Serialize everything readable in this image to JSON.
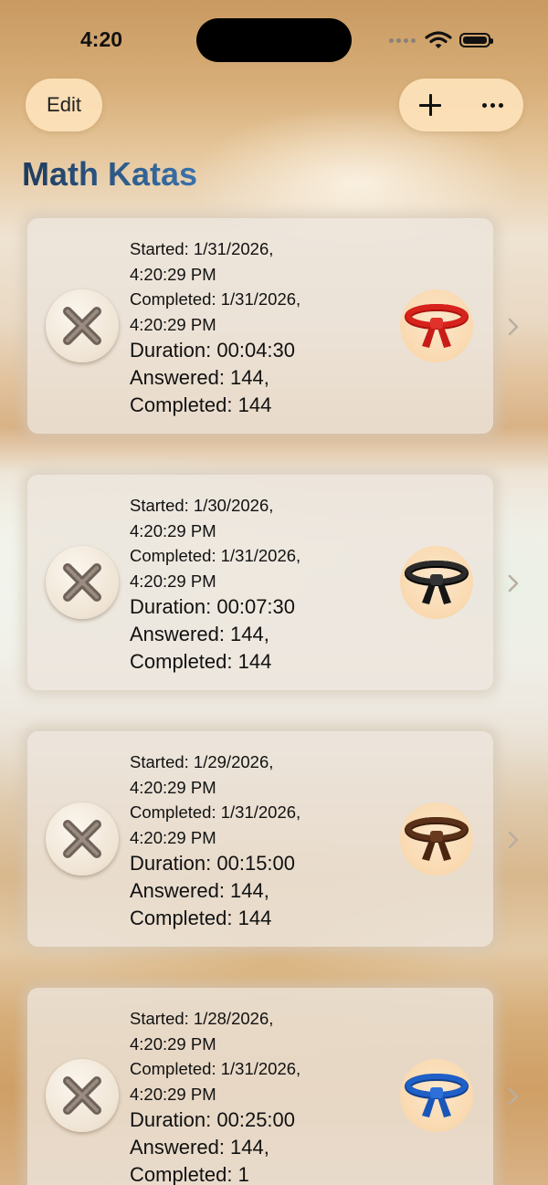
{
  "status_bar": {
    "time": "4:20"
  },
  "nav": {
    "edit_label": "Edit",
    "add_icon": "plus-icon",
    "more_icon": "ellipsis-icon"
  },
  "title": "Math Katas",
  "katas": [
    {
      "started": "Started: 1/31/2026,",
      "started_time": "4:20:29 PM",
      "completed": "Completed: 1/31/2026,",
      "completed_time": "4:20:29 PM",
      "duration": "Duration: 00:04:30",
      "answered": "Answered: 144,",
      "completed_count": "Completed: 144",
      "belt": "red-belt-icon",
      "belt_color": "#d8221c"
    },
    {
      "started": "Started: 1/30/2026,",
      "started_time": "4:20:29 PM",
      "completed": "Completed: 1/31/2026,",
      "completed_time": "4:20:29 PM",
      "duration": "Duration: 00:07:30",
      "answered": "Answered: 144,",
      "completed_count": "Completed: 144",
      "belt": "black-belt-icon",
      "belt_color": "#1a1a1a"
    },
    {
      "started": "Started: 1/29/2026,",
      "started_time": "4:20:29 PM",
      "completed": "Completed: 1/31/2026,",
      "completed_time": "4:20:29 PM",
      "duration": "Duration: 00:15:00",
      "answered": "Answered: 144,",
      "completed_count": "Completed: 144",
      "belt": "brown-belt-icon",
      "belt_color": "#5a3018"
    },
    {
      "started": "Started: 1/28/2026,",
      "started_time": "4:20:29 PM",
      "completed": "Completed: 1/31/2026,",
      "completed_time": "4:20:29 PM",
      "duration": "Duration: 00:25:00",
      "answered": "Answered: 144,",
      "completed_count": "Completed: 1",
      "belt": "blue-belt-icon",
      "belt_color": "#1f5fc8"
    }
  ],
  "colors": {
    "accent": "#2d5a8a",
    "button_fill": "#fde2ba"
  }
}
